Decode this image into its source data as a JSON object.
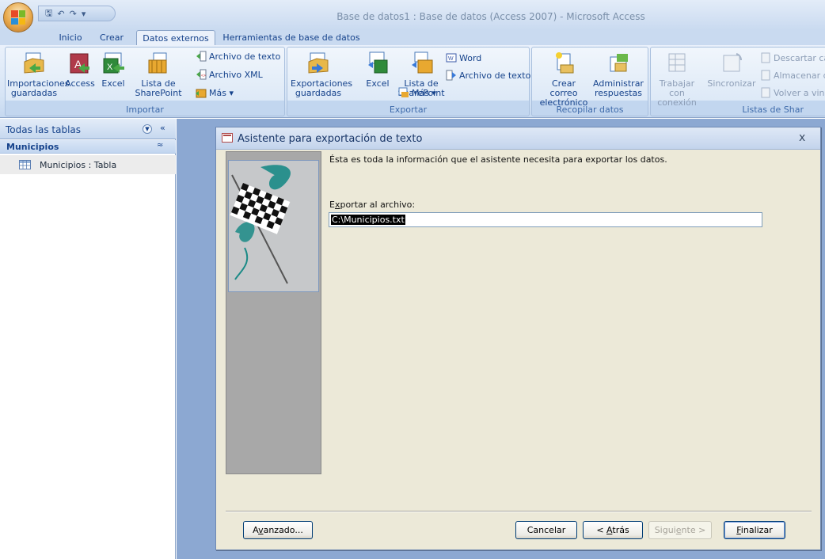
{
  "window": {
    "title": "Base de datos1 : Base de datos (Access 2007) - Microsoft Access"
  },
  "quick_access": {
    "save_icon": "save-icon",
    "undo_icon": "undo-icon",
    "redo_icon": "redo-icon",
    "customize_icon": "customize-icon"
  },
  "tabs": [
    {
      "label": "Inicio"
    },
    {
      "label": "Crear"
    },
    {
      "label": "Datos externos"
    },
    {
      "label": "Herramientas de base de datos"
    }
  ],
  "ribbon": {
    "importar": {
      "label": "Importar",
      "importaciones_guardadas": [
        "Importaciones",
        "guardadas"
      ],
      "access": "Access",
      "excel": "Excel",
      "lista_sharepoint": [
        "Lista de",
        "SharePoint"
      ],
      "archivo_texto": "Archivo de texto",
      "archivo_xml": "Archivo XML",
      "mas": "Más ▾"
    },
    "exportar": {
      "label": "Exportar",
      "exportaciones_guardadas": [
        "Exportaciones",
        "guardadas"
      ],
      "excel": "Excel",
      "lista_sharepoint": [
        "Lista de",
        "SharePoint"
      ],
      "word": "Word",
      "archivo_texto": "Archivo de texto",
      "mas": "Más ▾"
    },
    "recopilar": {
      "label": "Recopilar datos",
      "crear_correo": [
        "Crear correo",
        "electrónico"
      ],
      "administrar": [
        "Administrar",
        "respuestas"
      ]
    },
    "listas": {
      "label": "Listas de Shar",
      "trabajar": [
        "Trabajar con",
        "conexión"
      ],
      "sincronizar": "Sincronizar",
      "descartar": "Descartar ca",
      "almacenar": "Almacenar d",
      "volver": "Volver a vinc"
    }
  },
  "nav": {
    "header": "Todas las tablas",
    "dropdown_icon": "chevron-down-circle-icon",
    "collapse": "«",
    "group": "Municipios",
    "group_chevron": "≈",
    "item": "Municipios : Tabla"
  },
  "dialog": {
    "title": "Asistente para exportación de texto",
    "close": "x",
    "info": "Ésta es toda la información que el asistente necesita para exportar los datos.",
    "export_label_prefix": "E",
    "export_label_underline": "x",
    "export_label_rest": "portar al archivo:",
    "path": "C:\\Municipios.txt",
    "buttons": {
      "avanzado_a": "A",
      "avanzado_u": "v",
      "avanzado_rest": "anzado...",
      "cancelar": "Cancelar",
      "atras_pre": "< ",
      "atras_u": "A",
      "atras_rest": "trás",
      "siguiente_pre": "Sigui",
      "siguiente_u": "e",
      "siguiente_rest": "nte >",
      "finalizar_u": "F",
      "finalizar_rest": "inalizar"
    }
  },
  "colors": {
    "accent": "#15428b",
    "workspace": "#8ca8d2",
    "dialog_bg": "#ece9d8",
    "flag_teal": "#1a8a86"
  }
}
